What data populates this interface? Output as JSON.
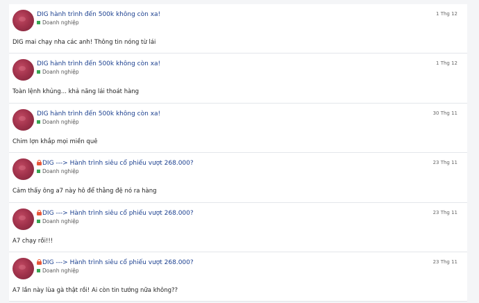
{
  "posts": [
    {
      "title": "DIG hành trình đến 500k không còn xa!",
      "locked": false,
      "category": "Doanh nghiệp",
      "date": "1 Thg 12",
      "content": "DIG mai chạy nha các anh! Thông tin nóng từ lái"
    },
    {
      "title": "DIG hành trình đến 500k không còn xa!",
      "locked": false,
      "category": "Doanh nghiệp",
      "date": "1 Thg 12",
      "content": "Toàn lệnh khủng... khả năng lái thoát hàng"
    },
    {
      "title": "DIG hành trình đến 500k không còn xa!",
      "locked": false,
      "category": "Doanh nghiệp",
      "date": "30 Thg 11",
      "content": "Chim lợn khắp mọi miền quê"
    },
    {
      "title": "DIG ---> Hành trình siêu cổ phiếu vượt 268.000?",
      "locked": true,
      "category": "Doanh nghiệp",
      "date": "23 Thg 11",
      "content": "Cảm thấy ông a7 này hô để thằng đệ nó ra hàng"
    },
    {
      "title": "DIG ---> Hành trình siêu cổ phiếu vượt 268.000?",
      "locked": true,
      "category": "Doanh nghiệp",
      "date": "23 Thg 11",
      "content": "A7 chạy rồi!!!"
    },
    {
      "title": "DIG ---> Hành trình siêu cổ phiếu vượt 268.000?",
      "locked": true,
      "category": "Doanh nghiệp",
      "date": "23 Thg 11",
      "content": "A7 lần này lùa gà thật rồi! Ai còn tin tướng nữa không??"
    }
  ]
}
